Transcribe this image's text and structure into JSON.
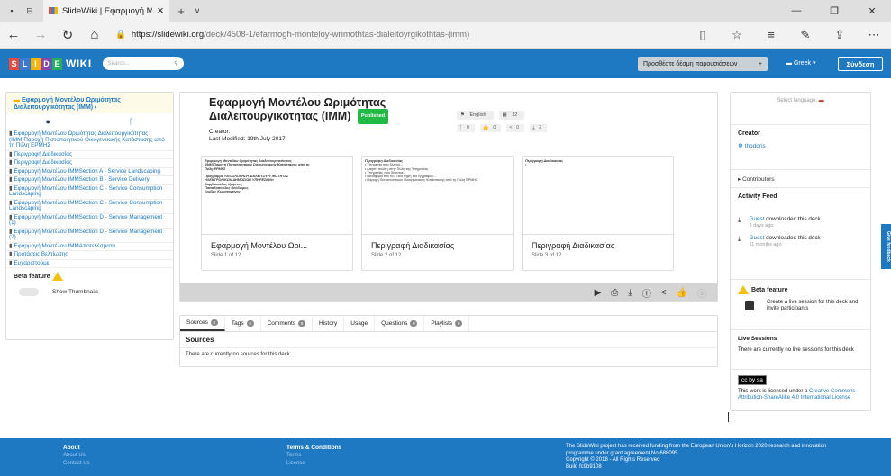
{
  "browser": {
    "tab_title": "SlideWiki | Εφαρμογή Μ",
    "url_host": "https://slidewiki.org",
    "url_path": "/deck/4508-1/efarmogh-monteloy-wrimothtas-dialeitoyrgikothtas-(imm)"
  },
  "nav": {
    "logo_letters": [
      "S",
      "L",
      "I",
      "D",
      "E"
    ],
    "logo_text": "WIKI",
    "search_placeholder": "Search...",
    "add_deck_label": "Προσθέστε δέσμη παρουσιάσεων",
    "language": "Greek",
    "signin": "Σύνδεση"
  },
  "tree": {
    "title": "Εφαρμογή Μοντέλου Ωριμότητας Διαλειτουργικότητας (IMM)",
    "items": [
      "Εφαρμογή Μοντέλου Ωριμότητας Διαλειτουργικότητας (ΙΜΜ)Παροχή Πιστοποιητικού Οικογενειακής Κατάστασης από τη Πύλη ΕΡΜΗΣ",
      "Περιγραφή Διαδικασίας",
      "Περιγραφή Διαδικασίας",
      "Εφαρμογή Μοντέλου IMMSection A - Service Landscaping",
      "Εφαρμογή Μοντέλου IMMSection B - Service Delivery",
      "Εφαρμογή Μοντέλου IMMSection C - Service Consumption Landscaping",
      "Εφαρμογή Μοντέλου IMMSection C - Service Consumption Landscaping",
      "Εφαρμογή Μοντέλου IMMSection D - Service Management (1)",
      "Εφαρμογή Μοντέλου IMMSection D - Service Management (2)",
      "Εφαρμογή Μοντέλου IMMΑποτελέσματα",
      "Προτάσεις Βελτίωσης",
      "Ευχαριστούμε"
    ],
    "beta_label": "Beta feature",
    "thumbnails_label": "Show Thumbnails"
  },
  "deck": {
    "title": "Εφαρμογή Μοντέλου Ωριμότητας Διαλειτουργικότητας (IMM)",
    "published": "Published",
    "creator": "Creator:",
    "modified": "Last Modified: 19th July 2017",
    "lang_chip": "English",
    "slides_chip": "12",
    "forks": "0",
    "likes": "0",
    "shares": "0",
    "downloads": "2"
  },
  "slides": [
    {
      "preview_lines": [
        "Εφαρμογή Μοντέλου Ωριμότητας Διαλειτουργικότητας",
        "(ΙΜΜ)Παροχή Πιστοποιητικού Οικογενειακής Κατάστασης από τη",
        "Πύλη ΕΡΜΗΣ",
        "Πρόγραμμα «ΑΞΙΟΛΟΓΗΣΗ ΔΙΑΛΕΙΤΟΥΡΓΙΚΟΤΗΤΑΣ",
        "ΗΛΕΚΤΡΟΝΙΚΩΝ ΔΗΜΟΣΙΩΝ ΥΠΗΡΕΣΙΩΝ»",
        "Βαμβακούλας Χρήστος",
        "Παπαδόπουλος Θεόδωρος",
        "Σούλας Κωνσταντίνος"
      ],
      "title": "Εφαρμογή Μοντέλου Ωρι...",
      "num": "Slide 1 of 12"
    },
    {
      "preview_lines": [
        "Περιγραφή Διαδικασίας",
        "• Υπηρεσία που δίνεται...",
        "• Αιτηση πολίτη στην Πύλη της Υπηρεσίας",
        "• Υπηρεσίες που δίνονται...",
        "• Μεταφορά στο ΚΕΠ και λήψη του εγγράφου...",
        "• Παροχή Πιστοποιητικού Οικογενειακής Κατάστασης από τη Πύλη ΕΡΜΗΣ"
      ],
      "title": "Περιγραφή Διαδικασίας",
      "num": "Slide 2 of 12"
    },
    {
      "preview_lines": [
        "Περιγραφή Διαδικασίας",
        "•"
      ],
      "title": "Περιγραφή Διαδικασίας",
      "num": "Slide 3 of 12"
    }
  ],
  "tabs": {
    "items": [
      {
        "label": "Sources",
        "count": "0"
      },
      {
        "label": "Tags",
        "count": "0"
      },
      {
        "label": "Comments",
        "count": "0"
      },
      {
        "label": "History",
        "count": ""
      },
      {
        "label": "Usage",
        "count": ""
      },
      {
        "label": "Questions",
        "count": "0"
      },
      {
        "label": "Playlists",
        "count": "0"
      }
    ],
    "section_title": "Sources",
    "empty_text": "There are currently no sources for this deck."
  },
  "right": {
    "select_language": "Select language:",
    "creator_heading": "Creator",
    "creator_name": "thodoris",
    "contributors": "Contributors",
    "activity_heading": "Activity Feed",
    "feed": [
      {
        "user": "Guest",
        "action": " downloaded this deck",
        "ago": "3 days ago"
      },
      {
        "user": "Guest",
        "action": " downloaded this deck",
        "ago": "11 months ago"
      }
    ],
    "beta_label": "Beta feature",
    "live_text": "Create a live session for this deck and invite participants",
    "live_heading": "Live Sessions",
    "live_empty": "There are currently no live sessions for this deck",
    "cc_badge": "cc by sa",
    "license_prefix": "This work is licensed under a ",
    "license_link": "Creative Commons Attribution-ShareAlike 4.0 International License"
  },
  "footer": {
    "about": "About",
    "about_us": "About Us",
    "contact_us": "Contact Us",
    "terms_heading": "Terms & Conditions",
    "terms": "Terms",
    "license": "License",
    "funding": "The SlideWiki project has received funding from the European Union's Horizon 2020 research and innovation programme under grant agreement No 688095",
    "copyright": "Copyright © 2018 - All Rights Reserved",
    "build": "Build fc9b9108"
  },
  "feedback_tab": "Give feedback",
  "colors": {
    "brand": "#1e78c2",
    "published": "#21ba45"
  }
}
